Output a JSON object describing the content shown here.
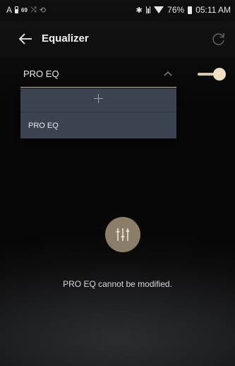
{
  "status_bar": {
    "brand": "A",
    "level": "69",
    "shuffle_icon": "shuffle-icon",
    "repeat_icon": "repeat-icon",
    "bluetooth_icon": "bluetooth-icon",
    "wifi_icon": "wifi-icon",
    "battery_percent": "76%",
    "time": "05:11 AM"
  },
  "header": {
    "title": "Equalizer",
    "back_icon": "arrow-left-icon",
    "reset_icon": "refresh-icon"
  },
  "preset": {
    "selected": "PRO EQ",
    "expanded": true,
    "toggle_on": true,
    "add_icon": "plus-icon",
    "options": [
      "PRO EQ"
    ]
  },
  "message": {
    "icon": "equalizer-sliders-icon",
    "text": "PRO EQ cannot be modified."
  },
  "colors": {
    "accent": "#d8cba5",
    "panel": "#3b4250",
    "icon_circle": "#8b7d67"
  }
}
